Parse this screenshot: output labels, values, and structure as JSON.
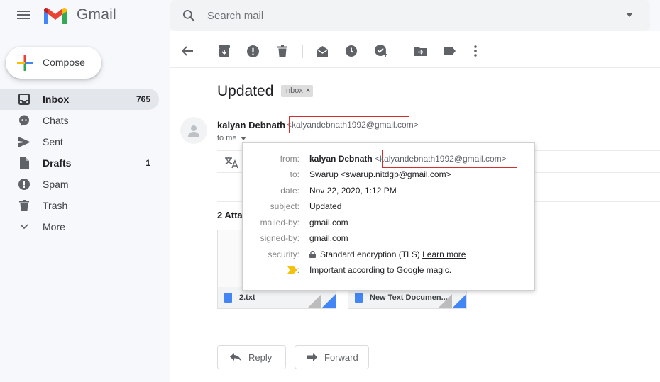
{
  "header": {
    "app_name": "Gmail",
    "search_placeholder": "Search mail"
  },
  "compose": {
    "label": "Compose"
  },
  "sidebar": {
    "items": [
      {
        "label": "Inbox",
        "count": "765",
        "icon": "inbox-icon",
        "active": true,
        "bold": true
      },
      {
        "label": "Chats",
        "count": "",
        "icon": "chat-icon"
      },
      {
        "label": "Sent",
        "count": "",
        "icon": "send-icon"
      },
      {
        "label": "Drafts",
        "count": "1",
        "icon": "draft-icon",
        "bold": true
      },
      {
        "label": "Spam",
        "count": "",
        "icon": "spam-icon"
      },
      {
        "label": "Trash",
        "count": "",
        "icon": "trash-icon"
      },
      {
        "label": "More",
        "count": "",
        "icon": "chevron-down-icon"
      }
    ]
  },
  "email": {
    "subject": "Updated",
    "label_chip": "Inbox",
    "label_chip_close": "×",
    "sender_name": "kalyan Debnath",
    "sender_email": "<kalyandebnath1992@gmail.com>",
    "to_me": "to me",
    "attachments_title": "2 Atta",
    "attachments": [
      {
        "name": "2.txt"
      },
      {
        "name": "New Text Documen..."
      }
    ],
    "reply_label": "Reply",
    "forward_label": "Forward"
  },
  "details_popup": {
    "from_key": "from:",
    "from_name": "kalyan Debnath",
    "from_email": "<kalyandebnath1992@gmail.com>",
    "to_key": "to:",
    "to_value": "Swarup <swarup.nitdgp@gmail.com>",
    "date_key": "date:",
    "date_value": "Nov 22, 2020, 1:12 PM",
    "subject_key": "subject:",
    "subject_value": "Updated",
    "mailedby_key": "mailed-by:",
    "mailedby_value": "gmail.com",
    "signedby_key": "signed-by:",
    "signedby_value": "gmail.com",
    "security_key": "security:",
    "security_value": "Standard encryption (TLS)",
    "security_link": "Learn more",
    "importance_key": ":",
    "importance_value": "Important according to Google magic."
  },
  "colors": {
    "importance_marker": "#f4c20d",
    "highlight_box": "#d32f2f",
    "active_nav": "#e3e6ea"
  }
}
